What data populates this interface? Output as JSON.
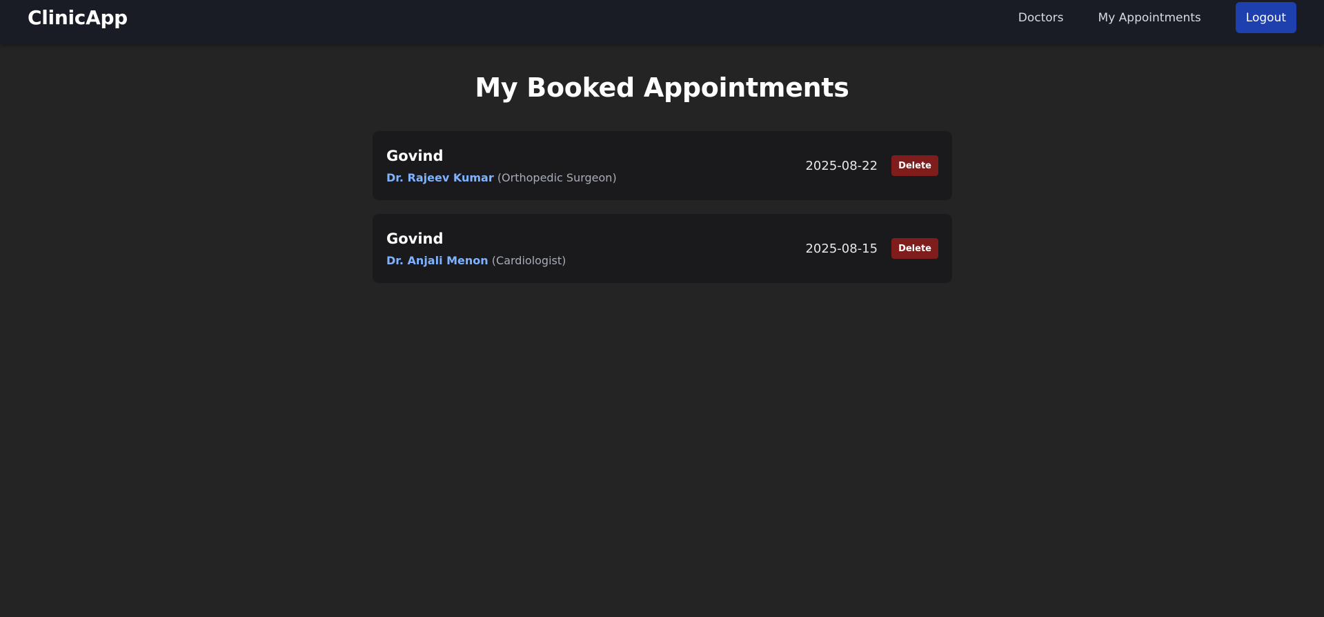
{
  "app": {
    "brand": "ClinicApp"
  },
  "nav": {
    "items": [
      {
        "label": "Doctors"
      },
      {
        "label": "My Appointments"
      }
    ],
    "logout_label": "Logout"
  },
  "page": {
    "title": "My Booked Appointments"
  },
  "appointments": [
    {
      "patient": "Govind",
      "doctor": "Dr. Rajeev Kumar",
      "specialty": "(Orthopedic Surgeon)",
      "date": "2025-08-22",
      "delete_label": "Delete"
    },
    {
      "patient": "Govind",
      "doctor": "Dr. Anjali Menon",
      "specialty": "(Cardiologist)",
      "date": "2025-08-15",
      "delete_label": "Delete"
    }
  ],
  "colors": {
    "background": "#242424",
    "navbar": "#191c25",
    "card": "#1a1a1c",
    "accent_blue": "#1e40af",
    "doctor_link": "#7fb3ff",
    "danger": "#7f1d1d"
  }
}
